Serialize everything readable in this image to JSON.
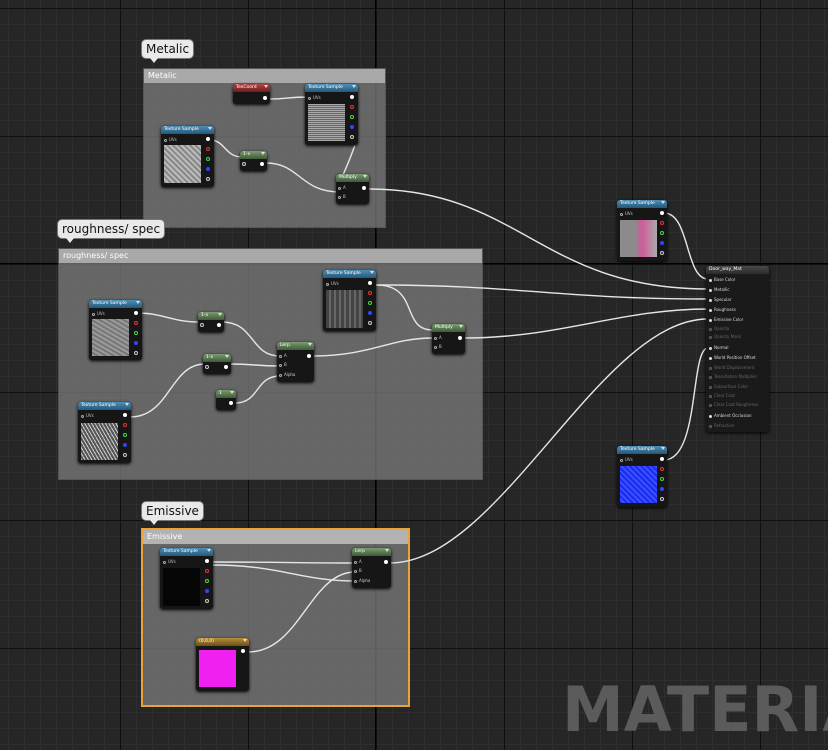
{
  "comments": {
    "metalic": {
      "bubble": "Metalic",
      "header": "Metalic"
    },
    "roughness": {
      "bubble": "roughness/ spec",
      "header": "roughness/ spec"
    },
    "emissive": {
      "bubble": "Emissive",
      "header": "Emissive"
    }
  },
  "nodes": {
    "texture_sample_label": "Texture Sample",
    "texcoord_label": "TexCoord",
    "multiply_label": "Multiply",
    "lerp_label": "Lerp",
    "oneminus_label": "1-x",
    "constant_label": "1",
    "color_label": "(0,0,0)",
    "pin_uvs": "UVs",
    "pin_a": "A",
    "pin_b": "B",
    "pin_alpha": "Alpha"
  },
  "material_node": {
    "title": "Door_way_Mat",
    "pins": [
      {
        "label": "Base Color",
        "active": true
      },
      {
        "label": "Metallic",
        "active": true
      },
      {
        "label": "Specular",
        "active": true
      },
      {
        "label": "Roughness",
        "active": true
      },
      {
        "label": "Emissive Color",
        "active": true
      },
      {
        "label": "Opacity",
        "active": false
      },
      {
        "label": "Opacity Mask",
        "active": false
      },
      {
        "label": "Normal",
        "active": true
      },
      {
        "label": "World Position Offset",
        "active": true
      },
      {
        "label": "World Displacement",
        "active": false
      },
      {
        "label": "Tessellation Multiplier",
        "active": false
      },
      {
        "label": "Subsurface Color",
        "active": false
      },
      {
        "label": "Clear Coat",
        "active": false
      },
      {
        "label": "Clear Coat Roughness",
        "active": false
      },
      {
        "label": "Ambient Occlusion",
        "active": true
      },
      {
        "label": "Refraction",
        "active": false
      }
    ]
  },
  "watermark": "MATERIAL",
  "colors": {
    "selection": "#e8a33a",
    "texture_header": "#3e7ca3",
    "emissive_color": "#f020f0",
    "normal_map": "#2233ee"
  }
}
